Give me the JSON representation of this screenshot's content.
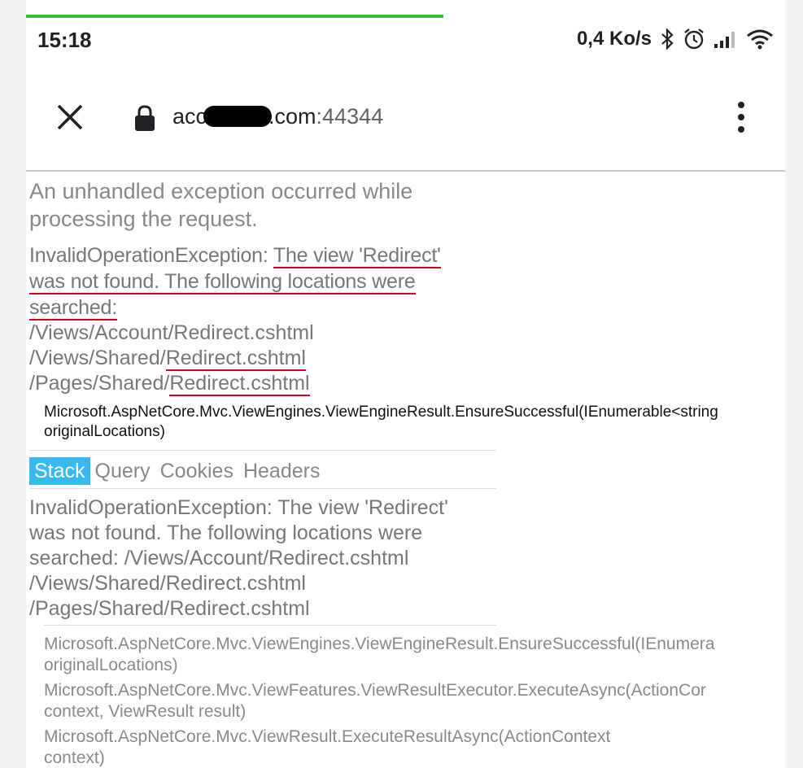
{
  "status_bar": {
    "time": "15:18",
    "network_speed": "0,4 Ko/s",
    "icons": [
      "bluetooth-icon",
      "alarm-icon",
      "signal-icon",
      "wifi-icon"
    ]
  },
  "browser": {
    "url_prefix": "acc",
    "url_suffix": ".com",
    "url_port": ":44344",
    "icons": [
      "close-icon",
      "lock-icon",
      "more-vert-icon"
    ],
    "page_progress": 0.55
  },
  "page": {
    "error_title": "An unhandled exception occurred while processing the request.",
    "exception_type": "InvalidOperationException:",
    "exception_message_part1": "The view 'Redirect'",
    "exception_message_part2": "was not found. The following locations were",
    "exception_message_part3": "searched:",
    "search_paths": [
      {
        "dir": "/Views/Account/",
        "file": "Redirect.cshtml"
      },
      {
        "dir": "/Views/Shared/",
        "file": "Redirect.cshtml"
      },
      {
        "dir": "/Pages/Shared/",
        "file": "Redirect.cshtml"
      }
    ],
    "throwing_method": "Microsoft.AspNetCore.Mvc.ViewEngines.ViewEngineResult.EnsureSuccessful(IEnumerable<string",
    "throwing_method_cont": "originalLocations)",
    "tabs": [
      "Stack",
      "Query",
      "Cookies",
      "Headers"
    ],
    "active_tab": "Stack",
    "stack_message_lines": [
      "InvalidOperationException: The view 'Redirect'",
      "was not found. The following locations were",
      "searched: /Views/Account/Redirect.cshtml",
      "/Views/Shared/Redirect.cshtml",
      "/Pages/Shared/Redirect.cshtml"
    ],
    "stack_frames": [
      {
        "line1": "Microsoft.AspNetCore.Mvc.ViewEngines.ViewEngineResult.EnsureSuccessful(IEnumera",
        "line2": "originalLocations)"
      },
      {
        "line1": "Microsoft.AspNetCore.Mvc.ViewFeatures.ViewResultExecutor.ExecuteAsync(ActionCor",
        "line2": "context, ViewResult result)"
      },
      {
        "line1": "Microsoft.AspNetCore.Mvc.ViewResult.ExecuteResultAsync(ActionContext",
        "line2": "context)"
      }
    ]
  },
  "colors": {
    "progress": "#36c33a",
    "annotation_underline": "#d0021b",
    "active_tab": "#37b8ee"
  }
}
